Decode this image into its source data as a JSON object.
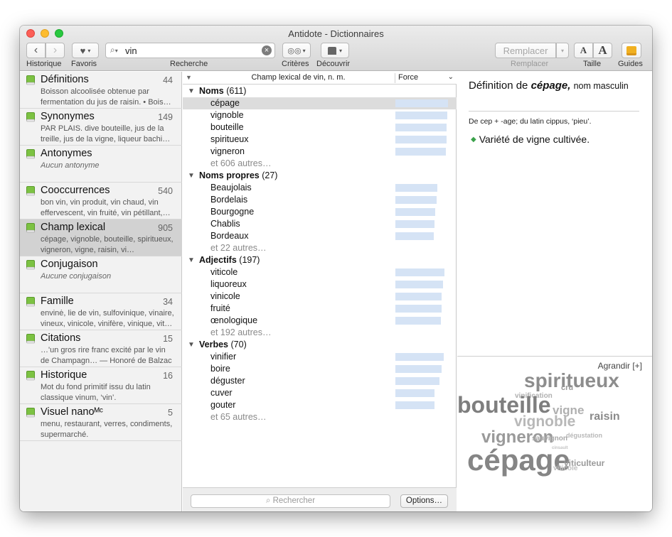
{
  "window": {
    "title": "Antidote - Dictionnaires"
  },
  "toolbar": {
    "search_value": "vin",
    "labels": {
      "historique": "Historique",
      "favoris": "Favoris",
      "recherche": "Recherche",
      "criteres": "Critères",
      "decouvrir": "Découvrir",
      "remplacer_label": "Remplacer",
      "taille": "Taille",
      "guides": "Guides"
    },
    "remplacer_button": "Remplacer",
    "taille_small": "A",
    "taille_large": "A"
  },
  "sidebar": {
    "items": [
      {
        "name": "Définitions",
        "count": "44",
        "desc": "Boisson alcoolisée obtenue par fermentation du jus de raisin. • Bois…",
        "italic": false
      },
      {
        "name": "Synonymes",
        "count": "149",
        "desc": "PAR PLAIS. dive bouteille, jus de la treille, jus de la vigne, liqueur bachi…",
        "italic": false
      },
      {
        "name": "Antonymes",
        "count": "",
        "desc": "Aucun antonyme",
        "italic": true
      },
      {
        "name": "Cooccurrences",
        "count": "540",
        "desc": "bon vin, vin produit, vin chaud, vin effervescent, vin fruité, vin pétillant,…",
        "italic": false
      },
      {
        "name": "Champ lexical",
        "count": "905",
        "desc": "cépage, vignoble, bouteille, spiritueux, vigneron, vigne, raisin, vi…",
        "italic": false
      },
      {
        "name": "Conjugaison",
        "count": "",
        "desc": "Aucune conjugaison",
        "italic": true
      },
      {
        "name": "Famille",
        "count": "34",
        "desc": "envinė, lie de vin, sulfovinique, vinaire, vineux, vinicole, vinifère, vinique, vit…",
        "italic": false
      },
      {
        "name": "Citations",
        "count": "15",
        "desc": "…'un gros rire franc excité par le vin de Champagn… — Honoré de Balzac",
        "italic": false
      },
      {
        "name": "Historique",
        "count": "16",
        "desc": "Mot du fond primitif issu du latin classique vinum, ‘vin’.",
        "italic": false
      },
      {
        "name": "Visuel nanoᴹᶜ",
        "count": "5",
        "desc": "menu, restaurant, verres, condiments, supermarché.",
        "italic": false
      }
    ]
  },
  "list": {
    "header": {
      "title": "Champ lexical de vin, n. m.",
      "force": "Force"
    },
    "groups": [
      {
        "label": "Noms",
        "count": "(611)",
        "words": [
          {
            "w": "cépage",
            "force": 0.98
          },
          {
            "w": "vignoble",
            "force": 0.96
          },
          {
            "w": "bouteille",
            "force": 0.95
          },
          {
            "w": "spiritueux",
            "force": 0.95
          },
          {
            "w": "vigneron",
            "force": 0.94
          }
        ],
        "more": "et 606 autres…"
      },
      {
        "label": "Noms propres",
        "count": "(27)",
        "words": [
          {
            "w": "Beaujolais",
            "force": 0.77
          },
          {
            "w": "Bordelais",
            "force": 0.76
          },
          {
            "w": "Bourgogne",
            "force": 0.74
          },
          {
            "w": "Chablis",
            "force": 0.72
          },
          {
            "w": "Bordeaux",
            "force": 0.71
          }
        ],
        "more": "et 22 autres…"
      },
      {
        "label": "Adjectifs",
        "count": "(197)",
        "words": [
          {
            "w": "viticole",
            "force": 0.91
          },
          {
            "w": "liquoreux",
            "force": 0.88
          },
          {
            "w": "vinicole",
            "force": 0.86
          },
          {
            "w": "fruité",
            "force": 0.85
          },
          {
            "w": "œnologique",
            "force": 0.84
          }
        ],
        "more": "et 192 autres…"
      },
      {
        "label": "Verbes",
        "count": "(70)",
        "words": [
          {
            "w": "vinifier",
            "force": 0.9
          },
          {
            "w": "boire",
            "force": 0.86
          },
          {
            "w": "déguster",
            "force": 0.81
          },
          {
            "w": "cuver",
            "force": 0.73
          },
          {
            "w": "gouter",
            "force": 0.72
          }
        ],
        "more": "et 65 autres…"
      }
    ],
    "bottom_search_placeholder": "Rechercher",
    "options_button": "Options…"
  },
  "definition": {
    "prefix": "Définition de",
    "word": "cépage,",
    "pos": "nom masculin",
    "etymology": "De cep + -age; du latin cippus, ‘pieu’.",
    "sense": "Variété de vigne cultivée."
  },
  "cloud": {
    "agrandir": "Agrandir [+]",
    "words": [
      {
        "t": "spiritueux",
        "color": "#8d8d8d"
      },
      {
        "t": "cru",
        "color": "#9a9a9a"
      },
      {
        "t": "vinification",
        "color": "#b0b0b0"
      },
      {
        "t": "bouteille",
        "color": "#7e7e7e"
      },
      {
        "t": "vigne",
        "color": "#b0b0b0"
      },
      {
        "t": "raisin",
        "color": "#8a8a8a"
      },
      {
        "t": "vignoble",
        "color": "#b8b8b8"
      },
      {
        "t": "dégustation",
        "color": "#b8b8b8"
      },
      {
        "t": "vigneron",
        "color": "#9a9a9a"
      },
      {
        "t": "sauvignon",
        "color": "#a8a8a8"
      },
      {
        "t": "cinsault",
        "color": "#c4c4c4"
      },
      {
        "t": "cépage",
        "color": "#858585"
      },
      {
        "t": "viticulteur",
        "color": "#9a9a9a"
      },
      {
        "t": "viticole",
        "color": "#c0c0c0"
      }
    ]
  },
  "colors": {
    "accent_book": "#7cc242",
    "force_bar": "#d5e3f5"
  }
}
